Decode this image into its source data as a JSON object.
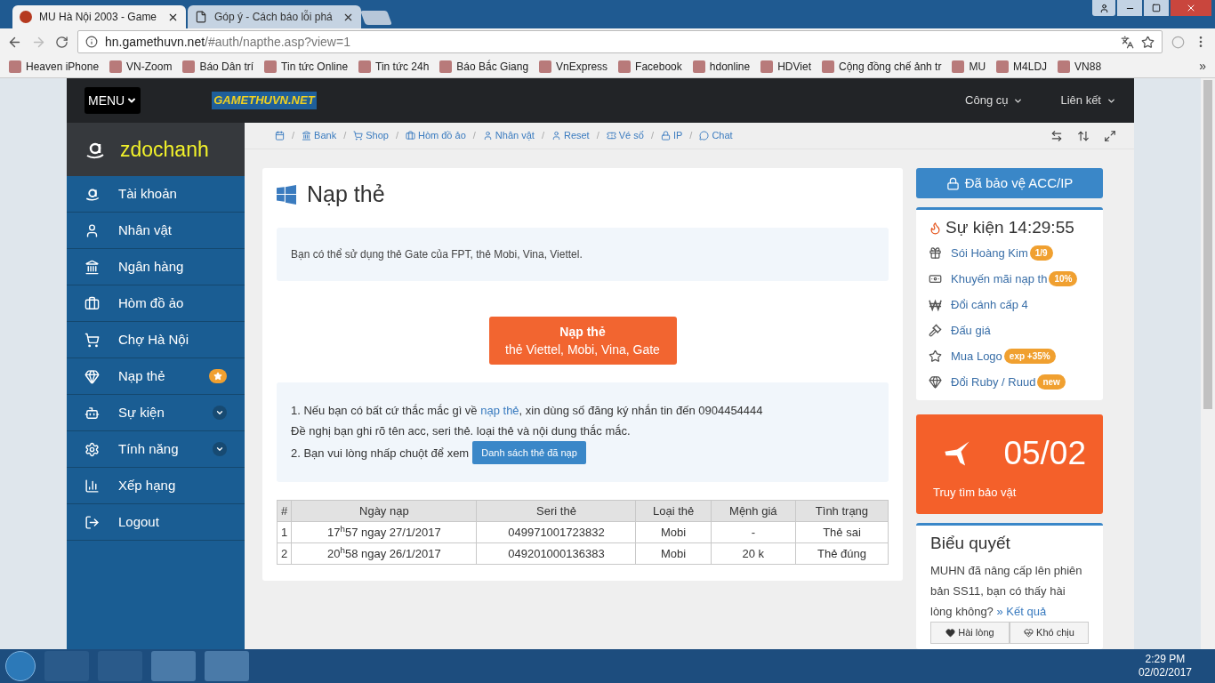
{
  "browser": {
    "tabs": [
      {
        "title": "MU Hà Nội 2003 - Game",
        "selected": true
      },
      {
        "title": "Góp ý - Cách báo lỗi phá",
        "selected": false
      }
    ],
    "url_host": "hn.gamethuvn.net",
    "url_path": "/#auth/napthe.asp?view=1",
    "bookmarks": [
      "Heaven iPhone",
      "VN-Zoom",
      "Báo Dân trí",
      "Tin tức Online",
      "Tin tức 24h",
      "Báo Bắc Giang",
      "VnExpress",
      "Facebook",
      "hdonline",
      "HDViet",
      "Cộng đồng chế ảnh tr",
      "MU",
      "M4LDJ",
      "VN88"
    ],
    "more": "»"
  },
  "navbar": {
    "menu": "MENU",
    "logo": "GAMETHUVN.NET",
    "links": [
      "Công cụ",
      "Liên kết"
    ]
  },
  "sidebar": {
    "username": "zdochanh",
    "items": [
      {
        "label": "Tài khoản",
        "kind": "plain"
      },
      {
        "label": "Nhân vật",
        "kind": "plain"
      },
      {
        "label": "Ngân hàng",
        "kind": "plain"
      },
      {
        "label": "Hòm đồ ảo",
        "kind": "plain"
      },
      {
        "label": "Chợ Hà Nội",
        "kind": "plain"
      },
      {
        "label": "Nạp thẻ",
        "kind": "starred"
      },
      {
        "label": "Sự kiện",
        "kind": "expandable",
        "expanded": false
      },
      {
        "label": "Tính năng",
        "kind": "expandable",
        "expanded": false
      },
      {
        "label": "Xếp hạng",
        "kind": "plain"
      },
      {
        "label": "Logout",
        "kind": "plain"
      }
    ]
  },
  "breadcrumb_separator": "/",
  "breadcrumb": [
    "Bank",
    "Shop",
    "Hòm đồ ảo",
    "Nhân vật",
    "Reset",
    "Vé số",
    "IP",
    "Chat"
  ],
  "main": {
    "title": "Nạp thẻ",
    "info": "Bạn có thể sử dụng thẻ Gate của FPT, thẻ Mobi, Vina, Viettel.",
    "topup_button": {
      "title": "Nạp thẻ",
      "subtitle": "thẻ Viettel, Mobi, Vina, Gate"
    },
    "notes": {
      "line1_before": "1. Nếu bạn có bất cứ thắc mắc gì về",
      "line1_link": "nạp thẻ",
      "line1_after": ", xin dùng số đăng ký nhắn tin đến 0904454444",
      "line2": "Đề nghị bạn ghi rõ tên acc, seri thẻ. loại thẻ và nội dung thắc mắc.",
      "line3": "2. Bạn vui lòng nhấp chuột để xem",
      "list_button": "Danh sách thẻ đã nạp"
    },
    "table": {
      "columns": [
        "#",
        "Ngày nạp",
        "Seri thẻ",
        "Loại thẻ",
        "Mệnh giá",
        "Tình trạng"
      ],
      "rows": [
        [
          "1",
          "17$^{h}$57 ngay 27/1/2017",
          "049971001723832",
          "Mobi",
          "-",
          "Thẻ sai"
        ],
        [
          "2",
          "20$^{h}$58 ngay 26/1/2017",
          "049201000136383",
          "Mobi",
          "20 k",
          "Thẻ đúng"
        ]
      ]
    }
  },
  "right": {
    "protect_button": "Đã bảo vệ ACC/IP",
    "events": {
      "title": "Sự kiện 14:29:55",
      "items": [
        {
          "label": "Sói Hoàng Kim",
          "badge": "1/9"
        },
        {
          "label": "Khuyến mãi nạp th",
          "badge": "10%"
        },
        {
          "label": "Đổi cánh cấp 4"
        },
        {
          "label": "Đấu giá"
        },
        {
          "label": "Mua Logo",
          "badge": "exp +35%"
        },
        {
          "label": "Đổi Ruby / Ruud",
          "badge": "new"
        }
      ]
    },
    "treasure": {
      "date": "05/02",
      "label": "Truy tìm bảo vật"
    },
    "vote": {
      "title": "Biểu quyết",
      "question": "MUHN đã nâng cấp lên phiên bản SS11, bạn có thấy hài lòng không?",
      "result_link": "» Kết quả",
      "options": [
        "Hài lòng",
        "Khó chịu"
      ]
    }
  },
  "taskbar": {
    "time": "2:29 PM",
    "date": "02/02/2017"
  }
}
